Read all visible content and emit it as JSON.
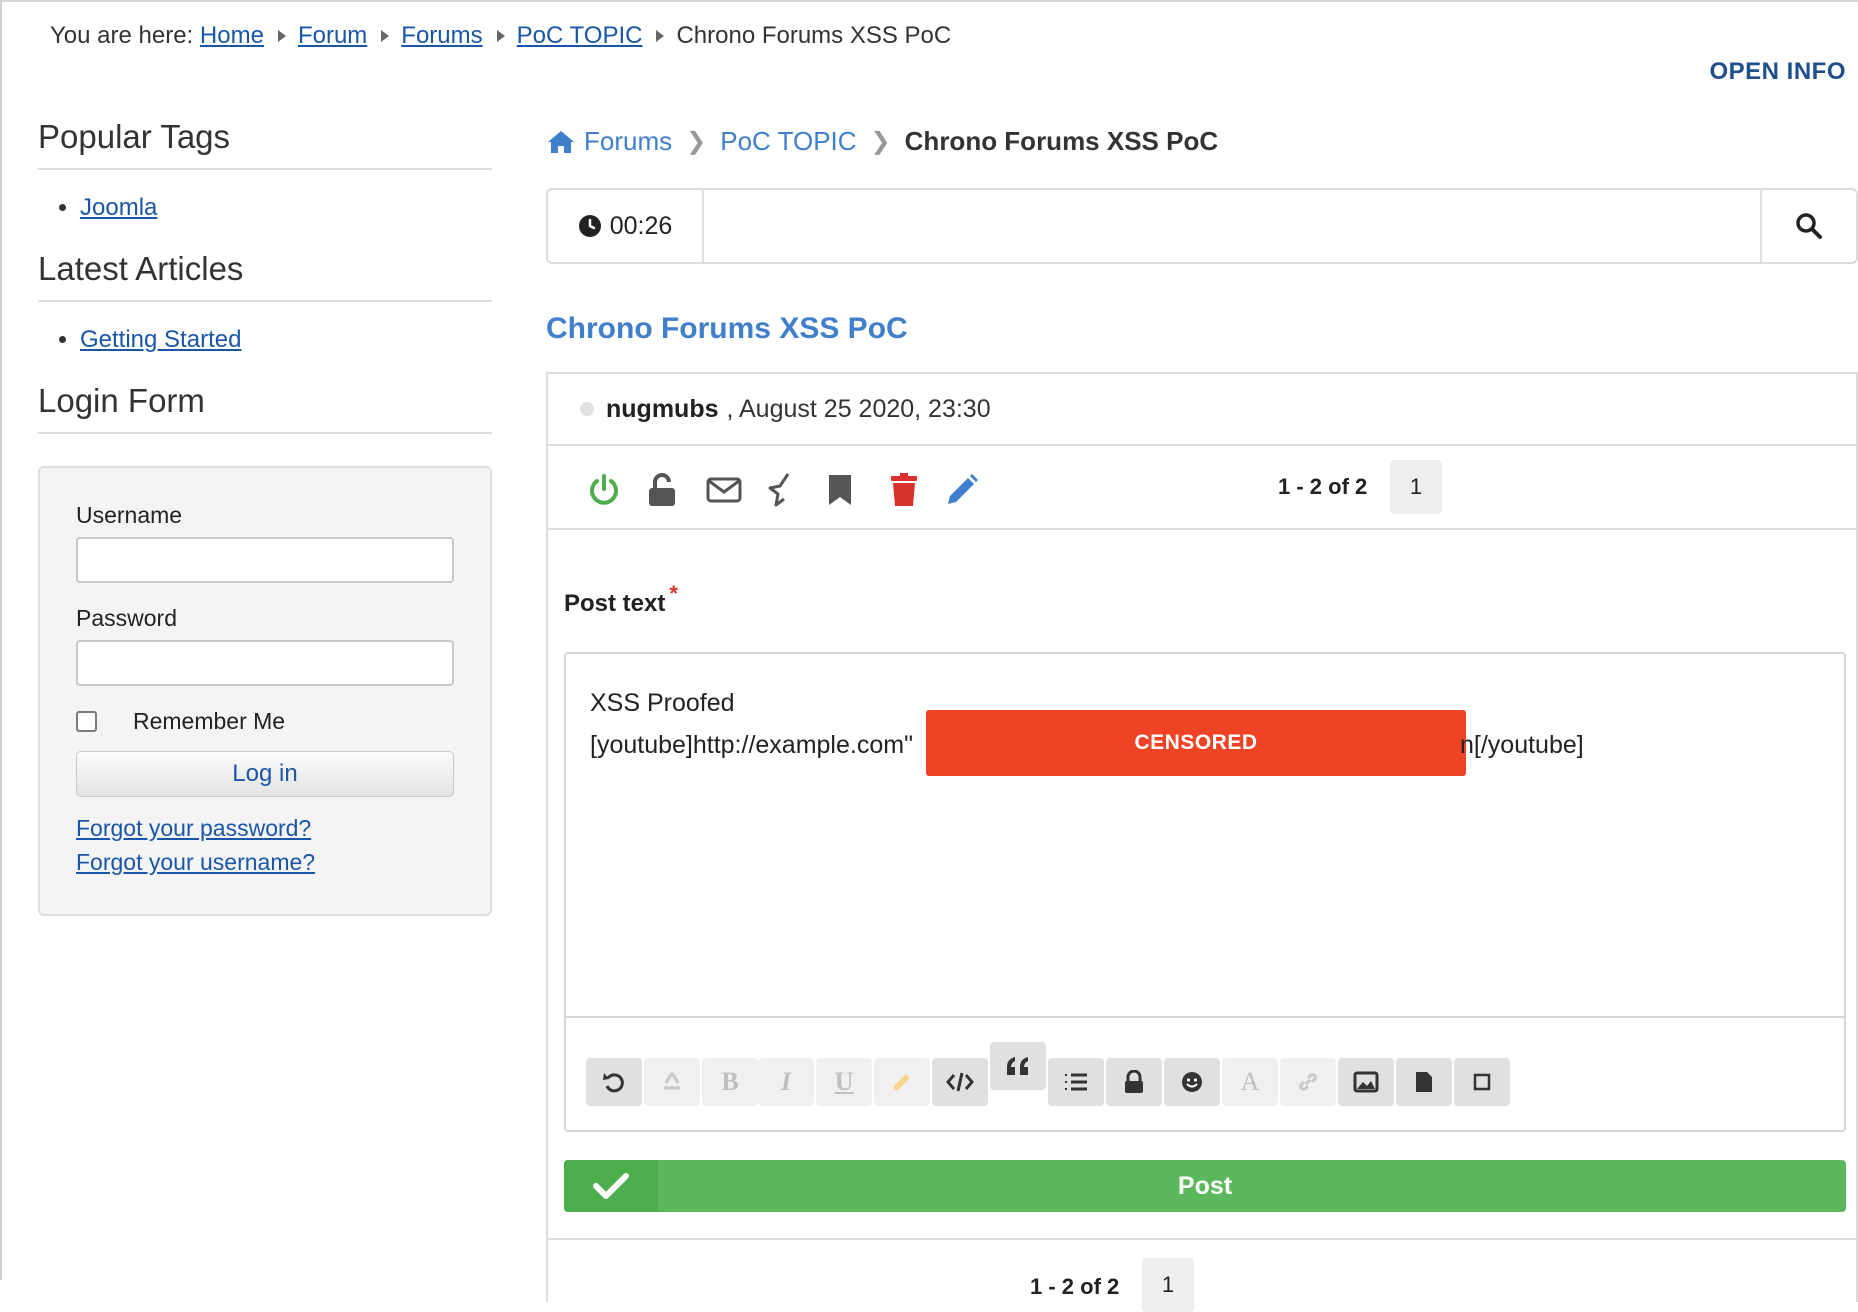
{
  "breadcrumb_top": {
    "prefix": "You are here:",
    "items": [
      "Home",
      "Forum",
      "Forums",
      "PoC TOPIC"
    ],
    "current": "Chrono Forums XSS PoC"
  },
  "open_info": "OPEN INFO",
  "sidebar": {
    "popular_tags": {
      "title": "Popular Tags",
      "items": [
        "Joomla"
      ]
    },
    "latest_articles": {
      "title": "Latest Articles",
      "items": [
        "Getting Started"
      ]
    },
    "login": {
      "title": "Login Form",
      "username_label": "Username",
      "username_value": "",
      "password_label": "Password",
      "password_value": "",
      "remember_label": "Remember Me",
      "login_button": "Log in",
      "forgot_password": "Forgot your password?",
      "forgot_username": "Forgot your username?"
    }
  },
  "forum_crumb": {
    "items": [
      "Forums",
      "PoC TOPIC"
    ],
    "current": "Chrono Forums XSS PoC"
  },
  "search": {
    "timer": "00:26",
    "value": ""
  },
  "topic": {
    "title": "Chrono Forums XSS PoC"
  },
  "post": {
    "author": "nugmubs",
    "date": ", August 25 2020, 23:30",
    "pager_text": "1 - 2 of 2",
    "page": "1"
  },
  "tools": {
    "colors": {
      "power": "#4cae4c",
      "delete": "#d9312b",
      "edit": "#3f7fcb",
      "neutral": "#555555"
    }
  },
  "editor": {
    "label": "Post text",
    "required_mark": "*",
    "line1": "XSS Proofed",
    "line2_start": "[youtube]http://example.com\"",
    "censored": "CENSORED",
    "line2_end": "n[/youtube]"
  },
  "post_button": "Post",
  "footer_pager": {
    "text": "1 - 2 of 2",
    "page": "1"
  }
}
